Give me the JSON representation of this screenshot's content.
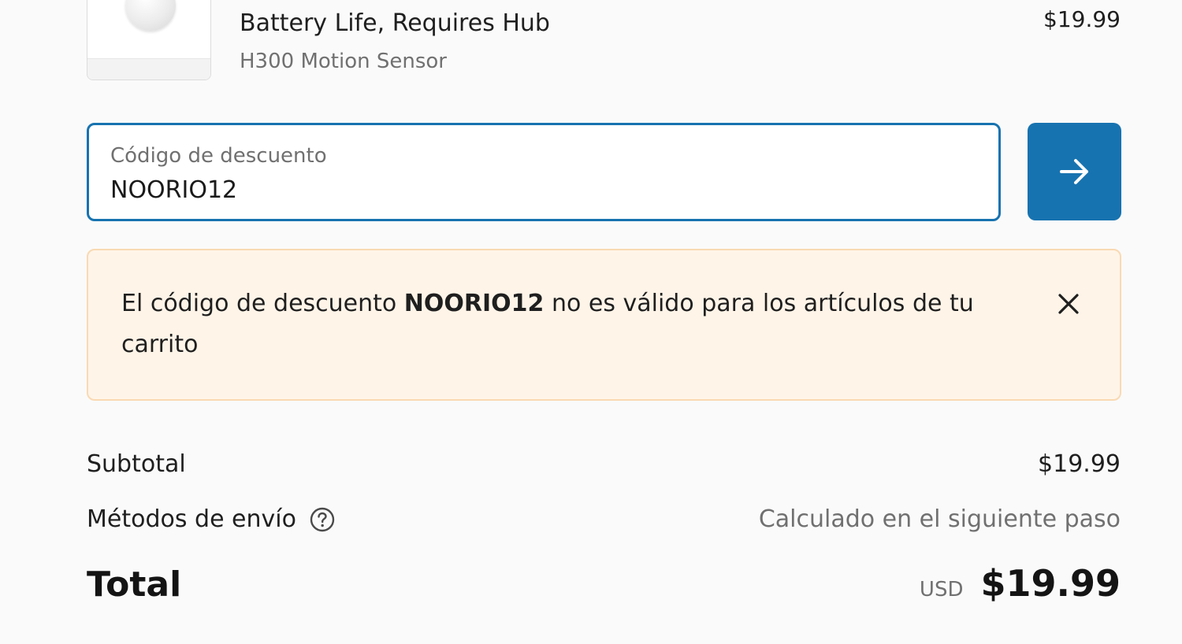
{
  "product": {
    "title": "Battery Life, Requires Hub",
    "variant": "H300 Motion Sensor",
    "price": "$19.99"
  },
  "discount": {
    "label": "Código de descuento",
    "value": "NOORIO12",
    "placeholder": "Código de descuento"
  },
  "error": {
    "prefix": "El código de descuento ",
    "code": "NOORIO12",
    "suffix": " no es válido para los artículos de tu carrito"
  },
  "summary": {
    "subtotal_label": "Subtotal",
    "subtotal_value": "$19.99",
    "shipping_label": "Métodos de envío",
    "shipping_value": "Calculado en el siguiente paso",
    "total_label": "Total",
    "total_currency": "USD",
    "total_amount": "$19.99"
  },
  "icons": {
    "apply": "arrow-right-icon",
    "close": "close-icon",
    "help": "question-circle-icon"
  },
  "colors": {
    "accent": "#1773b0",
    "error_bg": "#fff4e8",
    "error_border": "#f9d9b3"
  }
}
